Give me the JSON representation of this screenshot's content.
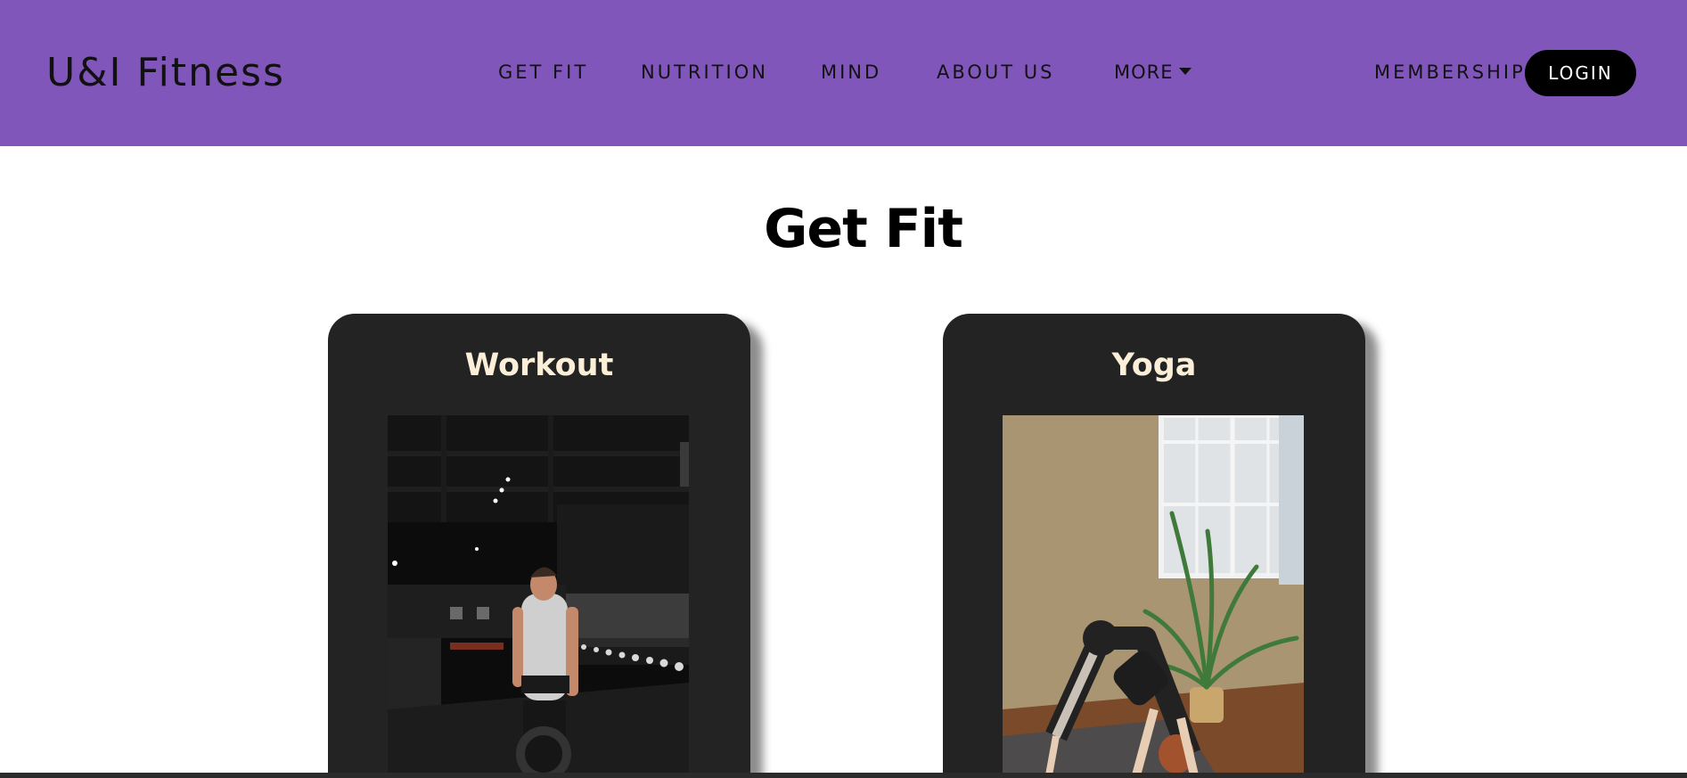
{
  "navbar": {
    "brand": "U&I Fitness",
    "links": [
      "GET FIT",
      "NUTRITION",
      "MIND",
      "ABOUT US"
    ],
    "more_label": "MORE",
    "membership_label": "MEMBERSHIP",
    "login_label": "LOGIN",
    "background_color": "#8156bb"
  },
  "main": {
    "title": "Get Fit",
    "cards": [
      {
        "title": "Workout"
      },
      {
        "title": "Yoga"
      }
    ]
  }
}
